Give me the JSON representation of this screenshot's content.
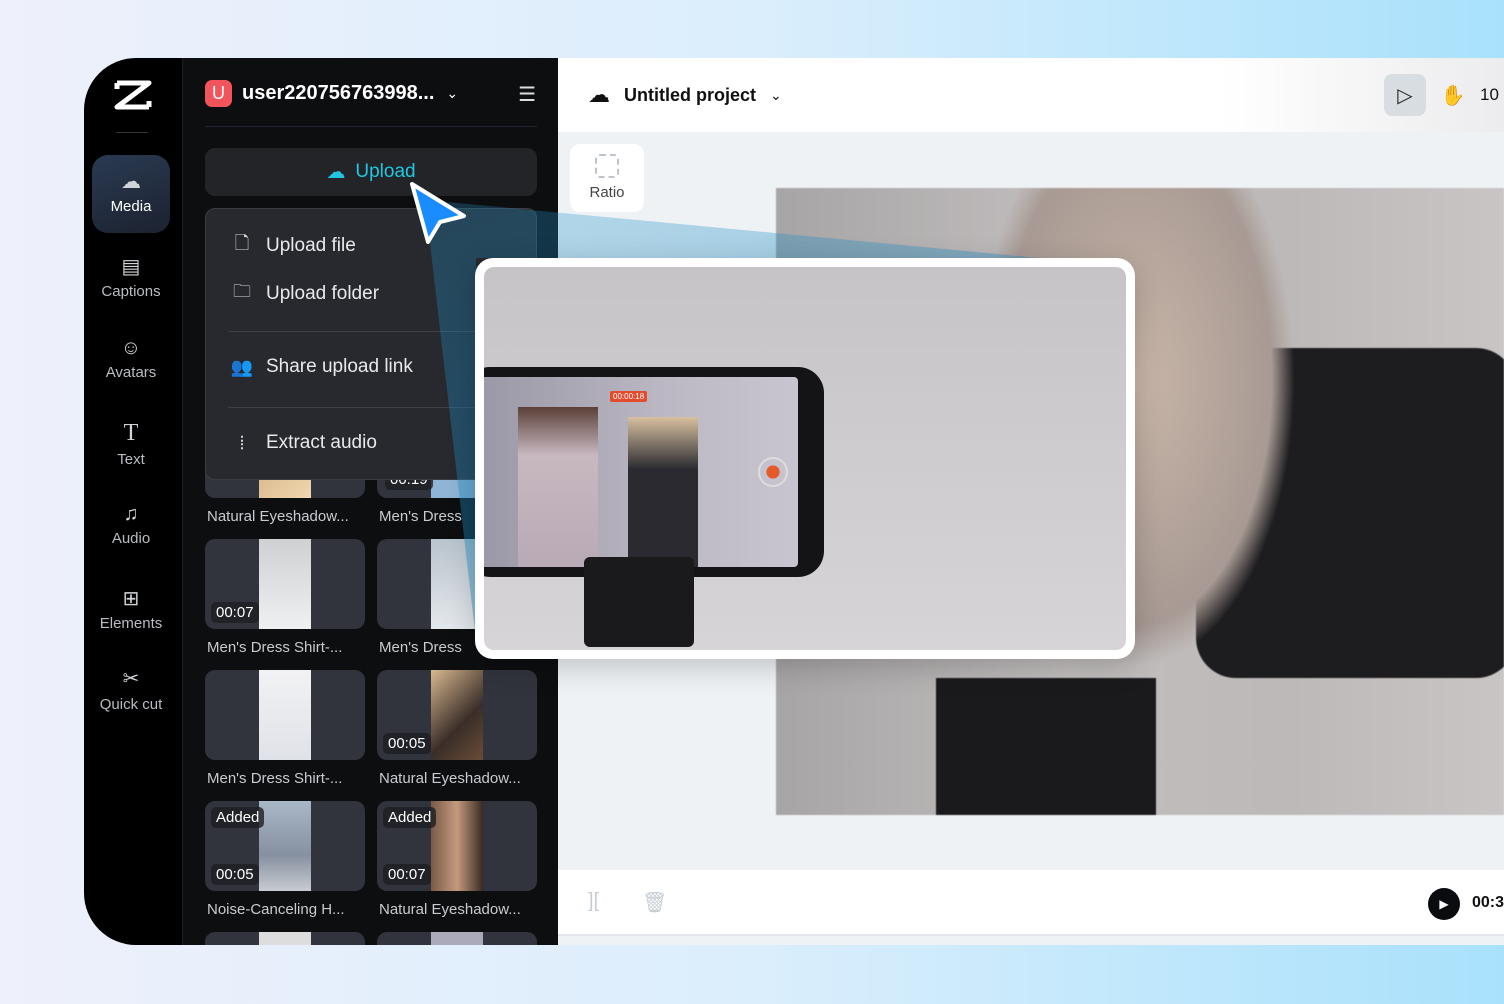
{
  "rail": {
    "items": [
      {
        "label": "Media",
        "icon": "cloud-upload-icon"
      },
      {
        "label": "Captions",
        "icon": "captions-icon"
      },
      {
        "label": "Avatars",
        "icon": "avatar-icon"
      },
      {
        "label": "Text",
        "icon": "text-icon"
      },
      {
        "label": "Audio",
        "icon": "music-note-icon"
      },
      {
        "label": "Elements",
        "icon": "elements-icon"
      },
      {
        "label": "Quick cut",
        "icon": "quick-cut-icon"
      }
    ]
  },
  "panel": {
    "user_initial": "U",
    "username": "user220756763998...",
    "upload_label": "Upload",
    "menu": [
      {
        "label": "Upload file",
        "icon": "file-upload-icon"
      },
      {
        "label": "Upload folder",
        "icon": "folder-upload-icon"
      },
      {
        "label": "Share upload link",
        "icon": "users-icon"
      },
      {
        "label": "Extract audio",
        "icon": "audio-wave-icon"
      }
    ],
    "media": [
      {
        "title": "Natural Eyeshadow...",
        "duration": "",
        "added": false
      },
      {
        "title": "Men's Dress",
        "duration": "00:19",
        "added": false
      },
      {
        "title": "Men's Dress Shirt-...",
        "duration": "00:07",
        "added": false
      },
      {
        "title": "Men's Dress",
        "duration": "",
        "added": false
      },
      {
        "title": "Men's Dress Shirt-...",
        "duration": "",
        "added": false
      },
      {
        "title": "Natural Eyeshadow...",
        "duration": "00:05",
        "added": false
      },
      {
        "title": "Noise-Canceling H...",
        "duration": "00:05",
        "added": true
      },
      {
        "title": "Natural Eyeshadow...",
        "duration": "00:07",
        "added": true
      }
    ],
    "added_label": "Added"
  },
  "header": {
    "project_title": "Untitled project",
    "zoom": "10"
  },
  "canvas": {
    "ratio_label": "Ratio",
    "rec_time": "00:00:18"
  },
  "timeline": {
    "time": "00:3"
  },
  "colors": {
    "accent": "#22c6e0",
    "cursor": "#1a8cff",
    "avatar": "#f2545b"
  }
}
